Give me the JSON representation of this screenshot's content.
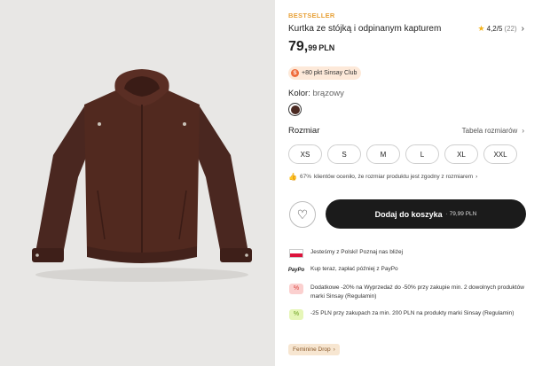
{
  "product": {
    "badge": "BESTSELLER",
    "title": "Kurtka ze stójką i odpinanym kapturem",
    "rating": "4,2/5",
    "rating_count": "(22)",
    "price_main": "79,",
    "price_cents": "99",
    "currency": "PLN",
    "club_points": "+80 pkt Sinsay Club",
    "color_label": "Kolor:",
    "color_value": "brązowy",
    "size_label": "Rozmiar",
    "size_chart": "Tabela rozmiarów",
    "sizes": [
      "XS",
      "S",
      "M",
      "L",
      "XL",
      "XXL"
    ],
    "fit_pct": "67%",
    "fit_text": "klientów oceniło, że rozmiar produktu jest zgodny z rozmiarem",
    "add_to_cart": "Dodaj do koszyka",
    "add_to_cart_price": "· 79,99 PLN",
    "feminine_tag": "Feminine Drop"
  },
  "info_items": [
    {
      "icon": "poland-flag-icon",
      "text": "Jesteśmy z Polski! Poznaj nas bliżej"
    },
    {
      "icon": "paypo-logo",
      "label": "PayPo",
      "text": "Kup teraz, zapłać później z PayPo"
    },
    {
      "icon": "discount-tag-icon",
      "text": "Dodatkowe -20% na Wyprzedaż do -50% przy zakupie min. 2 dowolnych produktów marki Sinsay (Regulamin)"
    },
    {
      "icon": "discount-tag-icon",
      "text": "-25 PLN przy zakupach za min. 200 PLN na produkty marki Sinsay (Regulamin)"
    }
  ],
  "colors": {
    "accent": "#e8a23a",
    "swatch": "#4b2a22",
    "cta": "#1b1b1b",
    "jacket": "#4a2720"
  }
}
